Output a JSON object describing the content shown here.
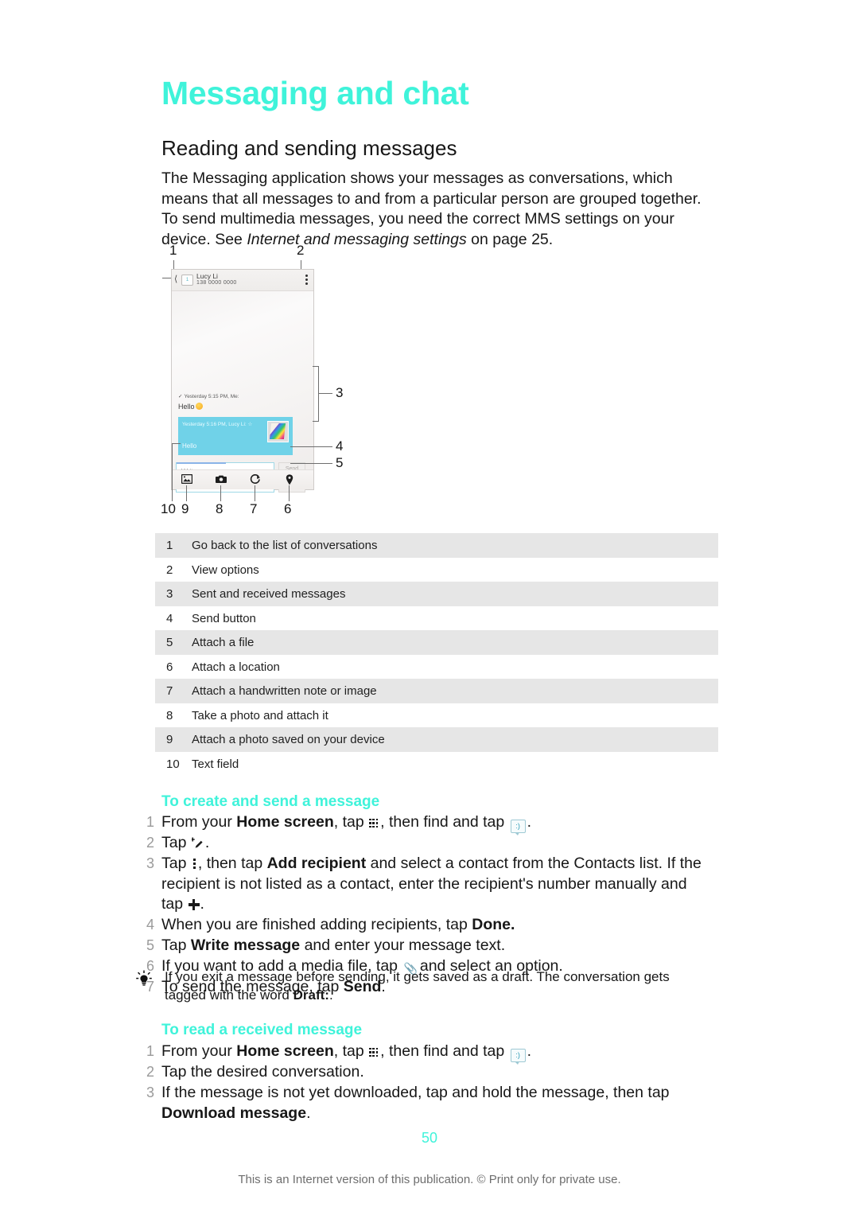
{
  "document": {
    "chapter_title": "Messaging and chat",
    "section_title": "Reading and sending messages",
    "intro_part1": "The Messaging application shows your messages as conversations, which means that all messages to and from a particular person are grouped together. To send multimedia messages, you need the correct MMS settings on your device. See ",
    "intro_italic": "Internet and messaging settings",
    "intro_part2": " on page 25.",
    "accent_color": "#3ff3da",
    "page_number": "50",
    "footer_note": "This is an Internet version of this publication. © Print only for private use."
  },
  "figure": {
    "callouts": [
      "1",
      "2",
      "3",
      "4",
      "5",
      "6",
      "7",
      "8",
      "9",
      "10"
    ],
    "phone": {
      "contact_name": "Lucy Li",
      "contact_number": "138 0000 0000",
      "sim_badge": "1",
      "back_icon": "back-chevron-icon",
      "more_icon": "overflow-menu-icon",
      "sent_meta": "Yesterday 5:15 PM, Me:",
      "sent_text": "Hello",
      "received_meta": "Yesterday 5:16 PM, Lucy Li:",
      "received_star": "☆",
      "received_text": "Hello",
      "input_placeholder": "Write message",
      "send_label": "Send",
      "attach_icon": "paperclip-icon",
      "toolbar_icons": [
        "gallery-icon",
        "camera-icon",
        "doodle-icon",
        "location-pin-icon"
      ]
    }
  },
  "legend": {
    "rows": [
      {
        "num": "1",
        "text": "Go back to the list of conversations"
      },
      {
        "num": "2",
        "text": "View options"
      },
      {
        "num": "3",
        "text": "Sent and received messages"
      },
      {
        "num": "4",
        "text": "Send button"
      },
      {
        "num": "5",
        "text": "Attach a file"
      },
      {
        "num": "6",
        "text": "Attach a location"
      },
      {
        "num": "7",
        "text": "Attach a handwritten note or image"
      },
      {
        "num": "8",
        "text": "Take a photo and attach it"
      },
      {
        "num": "9",
        "text": "Attach a photo saved on your device"
      },
      {
        "num": "10",
        "text": "Text field"
      }
    ]
  },
  "procedure_create": {
    "heading": "To create and send a message",
    "steps": [
      {
        "n": "1",
        "a": "From your ",
        "b1": "Home screen",
        "c": ", tap ",
        "icon1": "apps-grid-icon",
        "d": ", then find and tap ",
        "icon2": "messaging-icon",
        "e": "."
      },
      {
        "n": "2",
        "a": "Tap ",
        "icon1": "new-message-icon",
        "e": "."
      },
      {
        "n": "3",
        "a": "Tap ",
        "icon1": "overflow-menu-icon",
        "c": ", then tap ",
        "b1": "Add recipient",
        "d": " and select a contact from the Contacts list. If the recipient is not listed as a contact, enter the recipient's number manually and tap ",
        "icon2": "plus-icon",
        "e": "."
      },
      {
        "n": "4",
        "a": "When you are finished adding recipients, tap ",
        "b1": "Done."
      },
      {
        "n": "5",
        "a": "Tap ",
        "b1": "Write message",
        "c": " and enter your message text."
      },
      {
        "n": "6",
        "a": "If you want to add a media file, tap ",
        "icon1": "paperclip-icon",
        "c": " and select an option."
      },
      {
        "n": "7",
        "a": "To send the message, tap ",
        "b1": "Send",
        "c": "."
      }
    ]
  },
  "tip": {
    "icon": "lightbulb-icon",
    "text_part1": "If you exit a message before sending, it gets saved as a draft. The conversation gets tagged with the word ",
    "bold": "Draft:",
    "text_part2": "."
  },
  "procedure_read": {
    "heading": "To read a received message",
    "steps": [
      {
        "n": "1",
        "a": "From your ",
        "b1": "Home screen",
        "c": ", tap ",
        "icon1": "apps-grid-icon",
        "d": ", then find and tap ",
        "icon2": "messaging-icon",
        "e": "."
      },
      {
        "n": "2",
        "a": "Tap the desired conversation."
      },
      {
        "n": "3",
        "a": "If the message is not yet downloaded, tap and hold the message, then tap ",
        "b1": "Download message",
        "c": "."
      }
    ]
  }
}
